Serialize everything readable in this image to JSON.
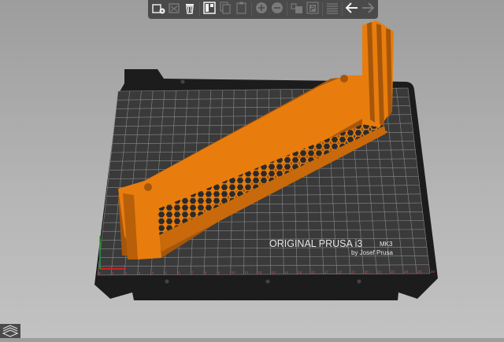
{
  "toolbar": {
    "buttons": [
      {
        "name": "add-button",
        "icon": "add-object-icon",
        "enabled": true
      },
      {
        "name": "delete-button",
        "icon": "delete-icon",
        "enabled": false
      },
      {
        "name": "delete-all-button",
        "icon": "trash-icon",
        "enabled": true
      },
      {
        "name": "arrange-button",
        "icon": "arrange-icon",
        "enabled": true
      },
      {
        "name": "copy-button",
        "icon": "copy-icon",
        "enabled": false
      },
      {
        "name": "paste-button",
        "icon": "paste-icon",
        "enabled": false
      },
      {
        "name": "add-instance-button",
        "icon": "plus-circle-icon",
        "enabled": false
      },
      {
        "name": "remove-instance-button",
        "icon": "minus-circle-icon",
        "enabled": false
      },
      {
        "name": "split-objects-button",
        "icon": "split-objects-icon",
        "enabled": false
      },
      {
        "name": "split-parts-button",
        "icon": "split-parts-icon",
        "enabled": false
      },
      {
        "name": "layers-editing-button",
        "icon": "layers-icon",
        "enabled": false
      },
      {
        "name": "undo-button",
        "icon": "undo-arrow-icon",
        "enabled": true
      },
      {
        "name": "redo-button",
        "icon": "redo-arrow-icon",
        "enabled": false
      }
    ]
  },
  "bed": {
    "brand_line1": "ORIGINAL PRUSA i3",
    "model": "MK3",
    "brand_line2": "by Josef Prusa",
    "x_ticks": [
      "0",
      "1",
      "2",
      "3",
      "4",
      "5",
      "6",
      "7",
      "8",
      "9",
      "10",
      "11",
      "12",
      "13",
      "14",
      "15",
      "16",
      "17",
      "18",
      "19",
      "20",
      "21",
      "22",
      "23",
      "24",
      "25"
    ],
    "surface_color": "#3a3a3a",
    "grid_color": "#8a8a8a"
  },
  "model": {
    "color": "#e87d0d",
    "shadow_color": "#a5560a"
  }
}
